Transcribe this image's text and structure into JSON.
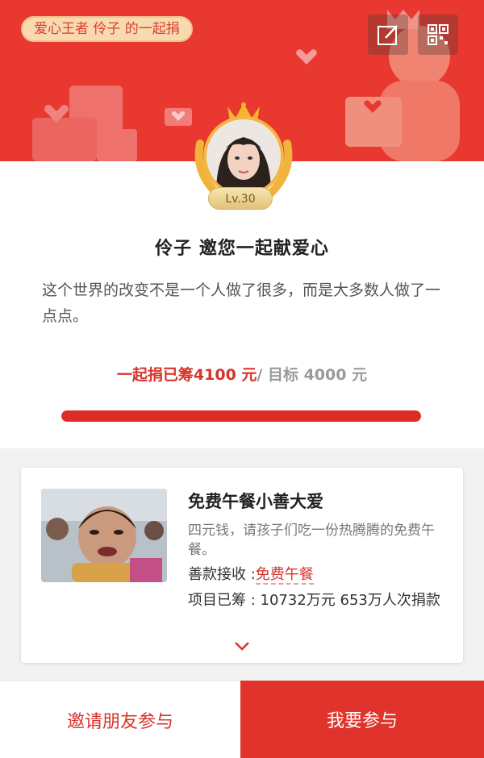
{
  "banner": {
    "honor_tag": "爱心王者 伶子 的一起捐",
    "edit_icon": "edit-icon",
    "qr_icon": "qr-code-icon"
  },
  "profile": {
    "level": "Lv.30",
    "invite_title": "伶子 邀您一起献爱心",
    "quote": "这个世界的改变不是一个人做了很多，而是大多数人做了一点点。"
  },
  "fundraising": {
    "raised_text": "一起捐已筹4100 元",
    "target_text": "/ 目标 4000 元",
    "progress": 1.0
  },
  "project": {
    "title": "免费午餐小善大爱",
    "description": "四元钱，请孩子们吃一份热腾腾的免费午餐。",
    "recipient_label": "善款接收 :",
    "recipient_name": "免费午餐",
    "raised_line": "项目已筹 : 10732万元 653万人次捐款"
  },
  "actions": {
    "invite_label": "邀请朋友参与",
    "join_label": "我要参与"
  },
  "colors": {
    "brand_red": "#e8382f",
    "accent_gold": "#f3b640"
  }
}
